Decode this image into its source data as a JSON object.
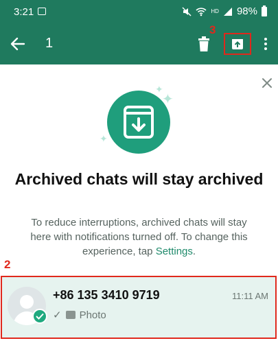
{
  "status_bar": {
    "time": "3:21",
    "battery": "98%",
    "hd": "HD"
  },
  "app_bar": {
    "selected_count": "1"
  },
  "annotations": {
    "step_archive": "3",
    "step_chat": "2"
  },
  "empty_state": {
    "title": "Archived chats will stay archived",
    "description": "To reduce interruptions, archived chats will stay here with notifications turned off. To change this experience, tap ",
    "settings_link": "Settings",
    "period": "."
  },
  "chat": {
    "name": "+86 135 3410 9719",
    "time": "11:11 AM",
    "status_check": "✓",
    "last_message": "Photo"
  },
  "colors": {
    "header": "#1f7a5e",
    "accent": "#1f9e7c",
    "highlight": "#e0281c",
    "link": "#1f8a6b"
  }
}
